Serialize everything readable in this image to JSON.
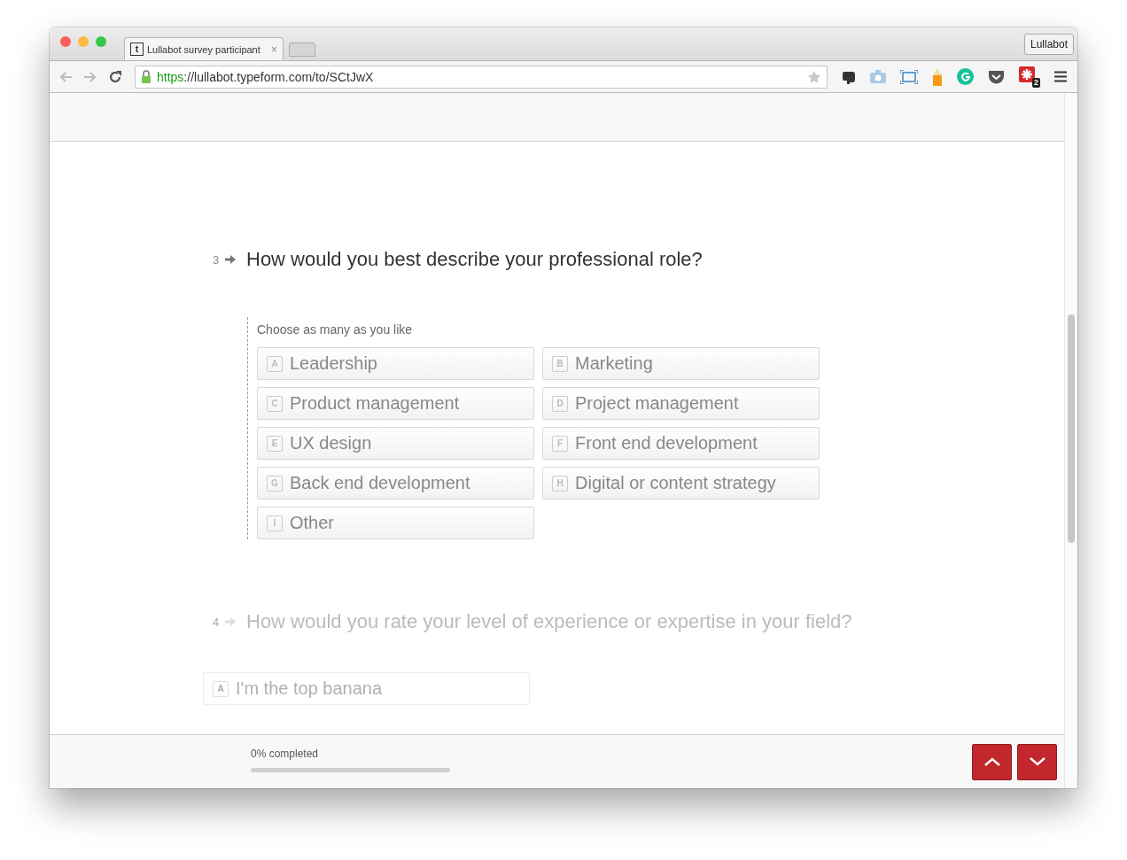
{
  "browser": {
    "tab": {
      "favicon": "t",
      "title": "Lullabot survey participant",
      "close": "×",
      "selected": true
    },
    "profile": "Lullabot",
    "url": {
      "scheme": "https",
      "rest": "://lullabot.typeform.com/to/SCtJwX",
      "secure": true
    },
    "extension_badge": "2"
  },
  "questions": [
    {
      "number": "3",
      "title": "How would you best describe your professional role?",
      "active": true,
      "hint": "Choose as many as you like",
      "options": [
        {
          "key": "A",
          "label": "Leadership",
          "selected": false
        },
        {
          "key": "B",
          "label": "Marketing",
          "selected": false
        },
        {
          "key": "C",
          "label": "Product management",
          "selected": false
        },
        {
          "key": "D",
          "label": "Project management",
          "selected": false
        },
        {
          "key": "E",
          "label": "UX design",
          "selected": false
        },
        {
          "key": "F",
          "label": "Front end development",
          "selected": false
        },
        {
          "key": "G",
          "label": "Back end development",
          "selected": false
        },
        {
          "key": "H",
          "label": "Digital or content strategy",
          "selected": false
        },
        {
          "key": "I",
          "label": "Other",
          "selected": false
        }
      ]
    },
    {
      "number": "4",
      "title": "How would you rate your level of experience or expertise in your field?",
      "active": false,
      "options": [
        {
          "key": "A",
          "label": "I'm the top banana",
          "selected": false
        }
      ]
    }
  ],
  "footer": {
    "progress_text": "0% completed",
    "level": 0
  }
}
